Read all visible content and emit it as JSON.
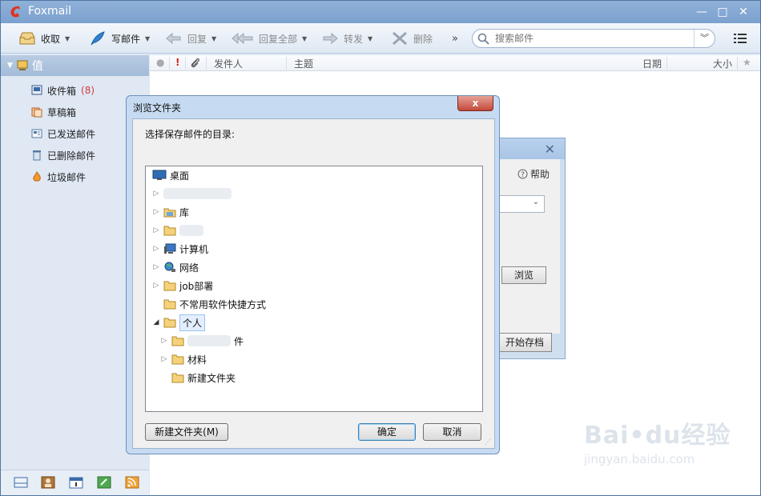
{
  "window": {
    "title": "Foxmail",
    "controls": [
      "—",
      "□",
      "✕"
    ]
  },
  "toolbar": {
    "receive": "收取",
    "compose": "写邮件",
    "reply": "回复",
    "reply_all": "回复全部",
    "forward": "转发",
    "delete": "删除",
    "more": "»",
    "search_placeholder": "搜索邮件"
  },
  "sidebar": {
    "account": "值",
    "folders": [
      {
        "label": "收件箱",
        "count": "(8)"
      },
      {
        "label": "草稿箱"
      },
      {
        "label": "已发送邮件"
      },
      {
        "label": "已删除邮件"
      },
      {
        "label": "垃圾邮件"
      }
    ]
  },
  "columns": {
    "flag": "!",
    "sender": "发件人",
    "subject": "主题",
    "date": "日期",
    "size": "大小"
  },
  "archive_dialog": {
    "help": "帮助",
    "browse": "浏览",
    "start": "开始存档"
  },
  "browse_dialog": {
    "title": "浏览文件夹",
    "close": "x",
    "prompt": "选择保存邮件的目录:",
    "tree": [
      {
        "label": "桌面"
      },
      {
        "label": ""
      },
      {
        "label": "库"
      },
      {
        "label": ""
      },
      {
        "label": "计算机"
      },
      {
        "label": "网络"
      },
      {
        "label": "job部署"
      },
      {
        "label": "不常用软件快捷方式"
      },
      {
        "label": "个人"
      },
      {
        "label": "件"
      },
      {
        "label": "材料"
      },
      {
        "label": "新建文件夹"
      }
    ],
    "new_folder": "新建文件夹(M)",
    "ok": "确定",
    "cancel": "取消"
  },
  "watermark": {
    "main": "Bai•du经验",
    "sub": "jingyan.baidu.com"
  }
}
